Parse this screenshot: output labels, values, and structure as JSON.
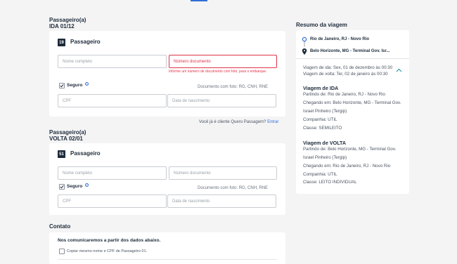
{
  "ida": {
    "heading_line1": "Passageiro(a)",
    "heading_line2": "IDA 01/12",
    "seat": "19",
    "title": "Passageiro",
    "name_placeholder": "Nome completo",
    "doc_placeholder": "Número documento",
    "doc_error": "Informe um número de documento com foto, para o embarque.",
    "insurance_label": "Seguro",
    "doc_hint": "Documento com foto: RG, CNH, RNE",
    "cpf_placeholder": "CPF",
    "birth_placeholder": "Data de nascimento"
  },
  "client_prompt": {
    "text": "Você já é cliente Quero Passagem?",
    "link": "Entrar"
  },
  "volta": {
    "heading_line1": "Passageiro(a)",
    "heading_line2": "VOLTA 02/01",
    "seat": "51",
    "title": "Passageiro",
    "name_placeholder": "Nome completo",
    "doc_placeholder": "Número documento",
    "insurance_label": "Seguro",
    "doc_hint": "Documento com foto: RG, CNH, RNE",
    "cpf_placeholder": "CPF",
    "birth_placeholder": "Data de nascimento"
  },
  "contato": {
    "heading": "Contato",
    "subtitle": "Nos comunicaremos a partir dos dados abaixo.",
    "copy_label": "Copiar mesmo nome e CPF de Passageiro 01."
  },
  "summary": {
    "heading": "Resumo da viagem",
    "origin": "Rio de Janeiro, RJ - Novo Rio",
    "destination": "Belo Horizonte, MG - Terminal Gov. Isr...",
    "ida_date": "Viagem de ida: Sex, 01 de dezembro às 00:30",
    "volta_date": "Viagem de volta: Ter, 02 de janeiro às 00:30",
    "ida": {
      "title": "Viagem de IDA",
      "from": "Partindo de: Rio de Janeiro, RJ - Novo Rio",
      "to_line1": "Chegando em: Belo Horizonte, MG - Terminal Gov.",
      "to_line2": "Israel Pinheiro (Tergip)",
      "company": "Companhia: UTIL",
      "class": "Classe: SEMILEITO"
    },
    "volta": {
      "title": "Viagem de VOLTA",
      "from_line1": "Partindo de: Belo Horizonte, MG - Terminal Gov.",
      "from_line2": "Israel Pinheiro (Tergip)",
      "to": "Chegando em: Rio de Janeiro, RJ - Novo Rio",
      "company": "Companhia: UTIL",
      "class": "Classe: LEITO INDIVIDUAL"
    }
  },
  "colors": {
    "accent": "#2f6fd6",
    "error": "#e0344b",
    "dark": "#1d2b3a"
  }
}
